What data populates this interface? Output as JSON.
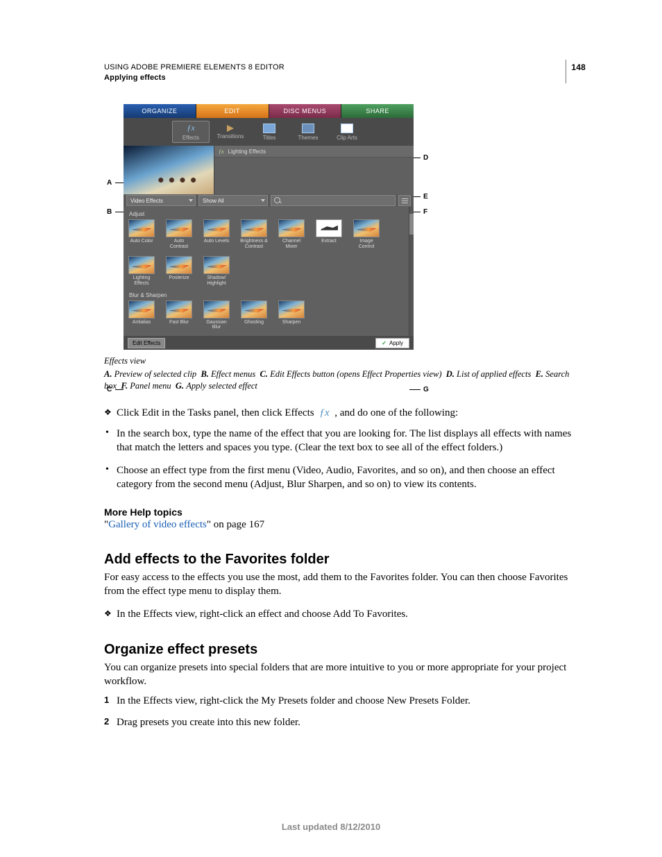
{
  "header": {
    "line1": "USING ADOBE PREMIERE ELEMENTS 8 EDITOR",
    "line2": "Applying effects",
    "page_number": "148"
  },
  "screenshot": {
    "tabs": {
      "organize": "ORGANIZE",
      "edit": "EDIT",
      "disc": "DISC MENUS",
      "share": "SHARE"
    },
    "subtabs": {
      "effects": "Effects",
      "transitions": "Transitions",
      "titles": "Titles",
      "themes": "Themes",
      "cliparts": "Clip Arts"
    },
    "applied_effect": "Lighting Effects",
    "menu_video": "Video Effects",
    "menu_showall": "Show All",
    "cat_adjust": "Adjust",
    "cat_blur": "Blur & Sharpen",
    "effects_adjust": [
      "Auto Color",
      "Auto Contrast",
      "Auto Levels",
      "Brightness & Contrast",
      "Channel Mixer",
      "Extract",
      "Image Control",
      "Lighting Effects",
      "Posterize",
      "Shadow/ Highlight"
    ],
    "effects_blur": [
      "Antialias",
      "Fast Blur",
      "Gaussian Blur",
      "Ghosting",
      "Sharpen"
    ],
    "btn_edit_effects": "Edit Effects",
    "btn_apply": "Apply"
  },
  "callouts": {
    "A": "A",
    "B": "B",
    "C": "C",
    "D": "D",
    "E": "E",
    "F": "F",
    "G": "G"
  },
  "figure": {
    "title": "Effects view",
    "A": "Preview of selected clip",
    "B": "Effect menus",
    "C": "Edit Effects button (opens Effect Properties view)",
    "D": "List of applied effects",
    "E": "Search box",
    "F": "Panel menu",
    "G": "Apply selected effect"
  },
  "instructions": {
    "lead_pre": "Click Edit in the Tasks panel, then click Effects ",
    "lead_post": " , and do one of the following:",
    "b1": "In the search box, type the name of the effect that you are looking for. The list displays all effects with names that match the letters and spaces you type. (Clear the text box to see all of the effect folders.)",
    "b2": "Choose an effect type from the first menu (Video, Audio, Favorites, and so on), and then choose an effect category from the second menu (Adjust, Blur Sharpen, and so on) to view its contents."
  },
  "more_help": {
    "heading": "More Help topics",
    "link_text": "Gallery of video effects",
    "suffix": "\" on page 167"
  },
  "sec1": {
    "heading": "Add effects to the Favorites folder",
    "p": "For easy access to the effects you use the most, add them to the Favorites folder. You can then choose Favorites from the effect type menu to display them.",
    "d1": "In the Effects view, right-click an effect and choose Add To Favorites."
  },
  "sec2": {
    "heading": "Organize effect presets",
    "p": "You can organize presets into special folders that are more intuitive to you or more appropriate for your project workflow.",
    "s1": "In the Effects view, right-click the My Presets folder and choose New Presets Folder.",
    "s2": "Drag presets you create into this new folder."
  },
  "footer": "Last updated 8/12/2010"
}
